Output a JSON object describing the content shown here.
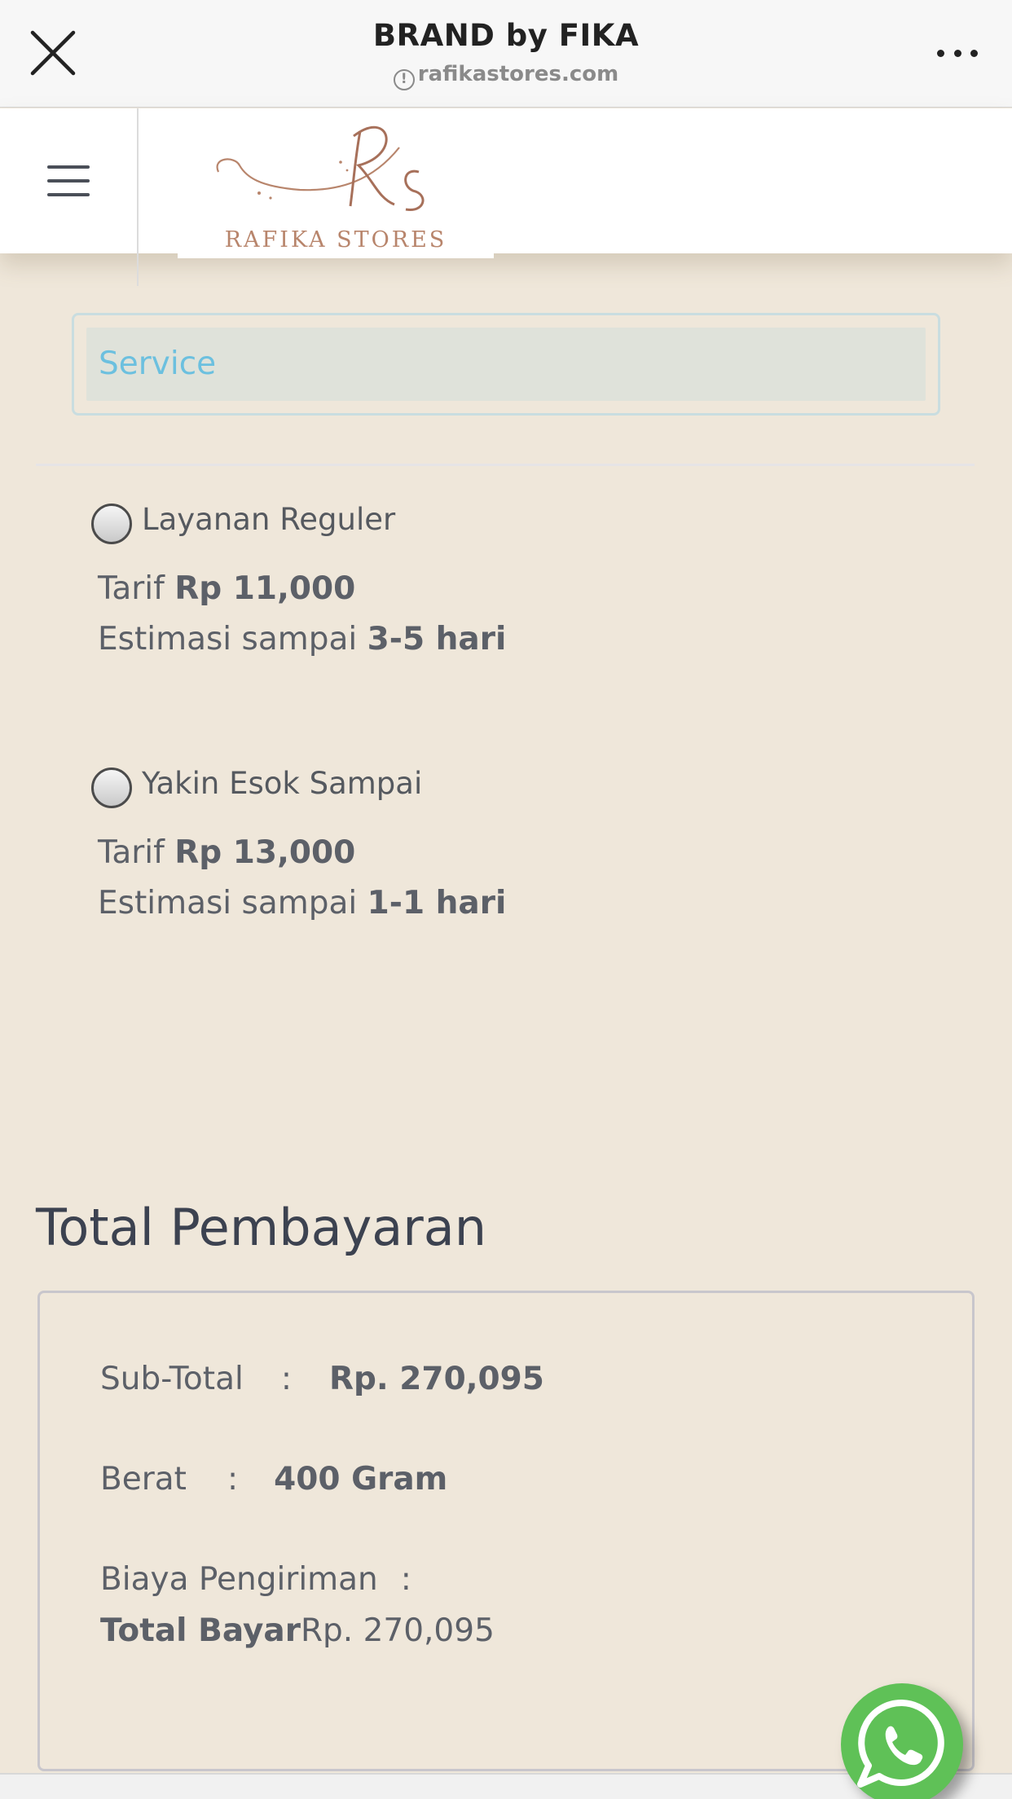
{
  "browser": {
    "title": "BRAND by FIKA",
    "url": "rafikastores.com",
    "info_glyph": "!"
  },
  "header": {
    "logo_text": "RAFIKA STORES"
  },
  "service": {
    "placeholder": "Service"
  },
  "options": [
    {
      "name": "Layanan Reguler",
      "tarif_label": "Tarif ",
      "tarif_value": "Rp 11,000",
      "estimasi_label": "Estimasi sampai ",
      "estimasi_value": "3-5 hari"
    },
    {
      "name": "Yakin Esok Sampai",
      "tarif_label": "Tarif ",
      "tarif_value": "Rp 13,000",
      "estimasi_label": "Estimasi sampai ",
      "estimasi_value": "1-1 hari"
    }
  ],
  "total": {
    "title": "Total Pembayaran",
    "subtotal_label": "Sub-Total",
    "subtotal_colon": ":",
    "subtotal_value": "Rp. 270,095",
    "berat_label": "Berat",
    "berat_colon": ":",
    "berat_value": "400 Gram",
    "biaya_label": "Biaya Pengiriman",
    "biaya_colon": ":",
    "bayar_label": "Total Bayar",
    "bayar_value": "Rp. 270,095"
  },
  "colors": {
    "page_bg": "#efe7da",
    "whatsapp": "#5fc157",
    "service_placeholder": "#6cc0df",
    "logo": "#b8856c"
  },
  "icons": [
    "close-icon",
    "info-icon",
    "more-icon",
    "menu-icon",
    "whatsapp-icon"
  ]
}
